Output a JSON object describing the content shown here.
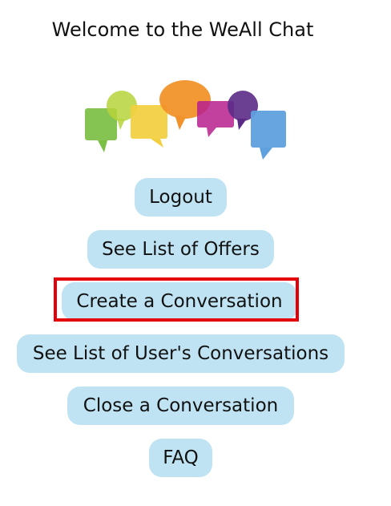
{
  "page": {
    "title": "Welcome to the WeAll Chat"
  },
  "logo": {
    "icon": "chat-bubbles-logo",
    "colors": [
      "#7bbf44",
      "#b6d43a",
      "#f2cf3f",
      "#f1922a",
      "#b7208e",
      "#5b2a86",
      "#5fa0df"
    ]
  },
  "menu": {
    "logout_label": "Logout",
    "offers_label": "See List of Offers",
    "create_conversation_label": "Create a Conversation",
    "user_conversations_label": "See List of User's Conversations",
    "close_conversation_label": "Close a Conversation",
    "faq_label": "FAQ"
  },
  "highlight": {
    "color": "#e3000b",
    "target": "create-conversation-button"
  }
}
